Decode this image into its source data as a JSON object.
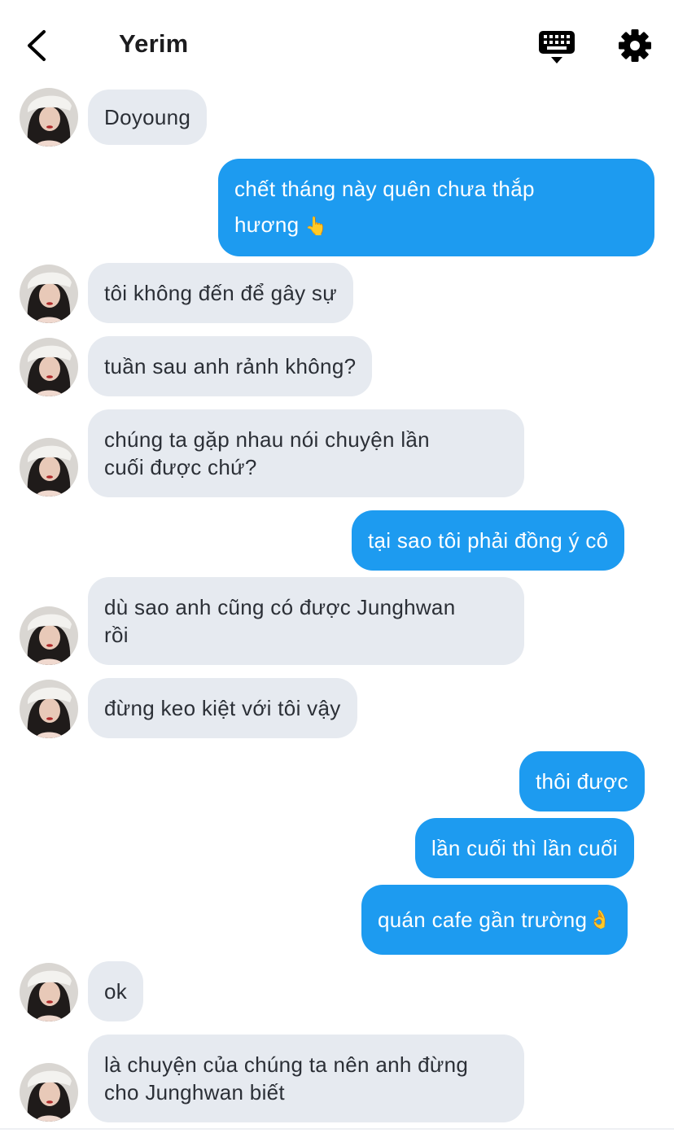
{
  "header": {
    "contact_name": "Yerim",
    "back_icon": "chevron-left-icon",
    "keyboard_icon": "keyboard-icon",
    "settings_icon": "gear-icon"
  },
  "colors": {
    "incoming_bubble": "#e6eaf0",
    "outgoing_bubble": "#1d9bf0",
    "incoming_text": "#2b2f36",
    "outgoing_text": "#ffffff"
  },
  "messages": [
    {
      "from": "them",
      "text": "Doyoung"
    },
    {
      "from": "me",
      "line1": "chết tháng này quên chưa thắp",
      "line2": "hương",
      "emoji": "👆"
    },
    {
      "from": "them",
      "text": "tôi không đến để gây sự"
    },
    {
      "from": "them",
      "text": "tuần sau anh rảnh không?"
    },
    {
      "from": "them",
      "line1": "chúng ta gặp nhau nói chuyện lần",
      "line2": "cuối được chứ?"
    },
    {
      "from": "me",
      "text": "tại sao tôi phải đồng ý cô"
    },
    {
      "from": "them",
      "line1": "dù sao anh cũng có được Junghwan",
      "line2": "rồi"
    },
    {
      "from": "them",
      "text": "đừng keo kiệt với tôi vậy"
    },
    {
      "from": "me",
      "text": "thôi được"
    },
    {
      "from": "me",
      "text": "lần cuối thì lần cuối"
    },
    {
      "from": "me",
      "text": "quán cafe gần trường",
      "emoji": "👌"
    },
    {
      "from": "them",
      "text": "ok"
    },
    {
      "from": "them",
      "line1": "là chuyện của chúng ta nên anh đừng",
      "line2": "cho Junghwan biết"
    }
  ]
}
